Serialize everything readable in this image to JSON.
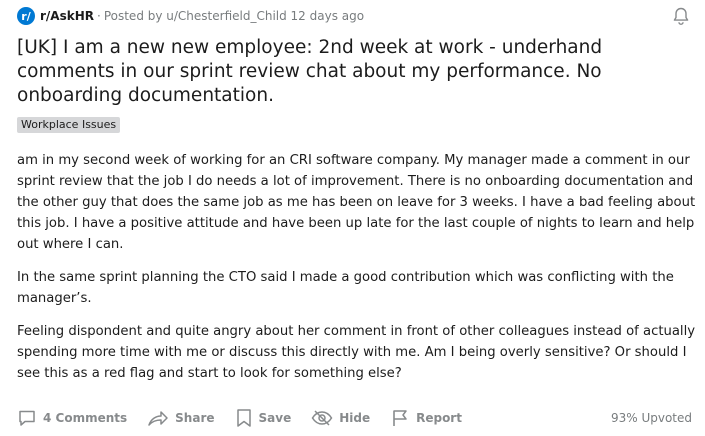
{
  "post": {
    "subreddit": "r/AskHR",
    "subreddit_initial": "r/",
    "posted_by": "Posted by u/Chesterfield_Child 12 days ago",
    "separator": "·",
    "title": "[UK] I am a new new employee: 2nd week at work - underhand comments in our sprint review chat about my performance. No onboarding documentation.",
    "flair": "Workplace Issues",
    "paragraphs": [
      "am in my second week of working for an CRI software company. My manager made a comment in our sprint review that the job I do needs a lot of improvement. There is no onboarding documentation and the other guy that does the same job as me has been on leave for 3 weeks. I have a bad feeling about this job. I have a positive attitude and have been up late for the last couple of nights to learn and help out where I can.",
      "In the same sprint planning the CTO said I made a good contribution which was conflicting with the manager’s.",
      "Feeling dispondent and quite angry about her comment in front of other colleagues instead of actually spending more time with me or discuss this directly with me. Am I being overly sensitive? Or should I see this as a red flag and start to look for something else?"
    ]
  },
  "actions": {
    "comments": "4 Comments",
    "share": "Share",
    "save": "Save",
    "hide": "Hide",
    "report": "Report",
    "upvoted": "93% Upvoted"
  },
  "colors": {
    "subreddit_icon": "#0079d3",
    "action_gray": "#878a8c",
    "flair_bg": "#d6d7d9"
  },
  "icons": [
    "subreddit-icon",
    "bell-icon",
    "comment-icon",
    "share-icon",
    "bookmark-icon",
    "hide-icon",
    "report-flag-icon"
  ]
}
